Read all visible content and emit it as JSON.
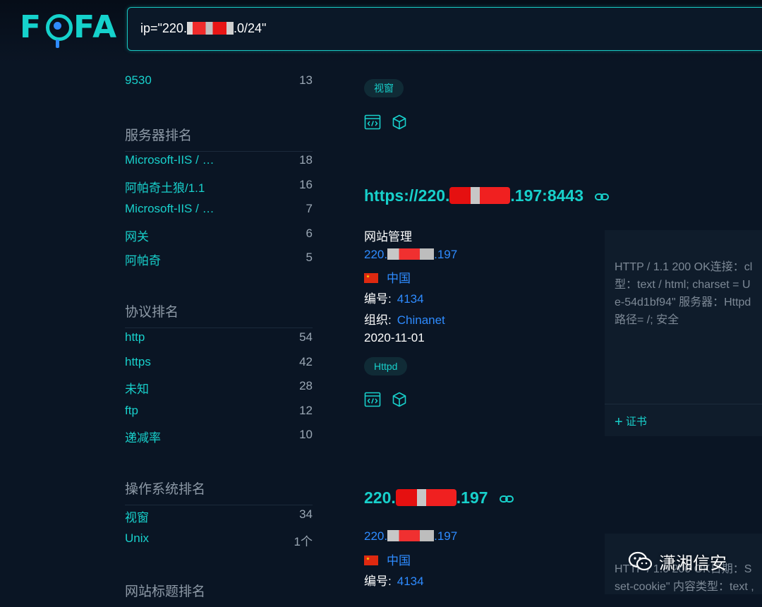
{
  "header": {
    "logo": "FOFA",
    "search_value": "ip=\"220.",
    "search_suffix": ".0/24\""
  },
  "sidebar": {
    "top_item": {
      "label": "9530",
      "count": "13"
    },
    "server_rank": {
      "title": "服务器排名",
      "items": [
        {
          "label": "Microsoft-IIS / …",
          "count": "18"
        },
        {
          "label": "阿帕奇土狼/1.1",
          "count": "16"
        },
        {
          "label": "Microsoft-IIS / …",
          "count": "7"
        },
        {
          "label": "网关",
          "count": "6"
        },
        {
          "label": "阿帕奇",
          "count": "5"
        }
      ]
    },
    "protocol_rank": {
      "title": "协议排名",
      "items": [
        {
          "label": "http",
          "count": "54"
        },
        {
          "label": "https",
          "count": "42"
        },
        {
          "label": "未知",
          "count": "28"
        },
        {
          "label": "ftp",
          "count": "12"
        },
        {
          "label": "递减率",
          "count": "10"
        }
      ]
    },
    "os_rank": {
      "title": "操作系统排名",
      "items": [
        {
          "label": "视窗",
          "count": "34"
        },
        {
          "label": "Unix",
          "count": "1个"
        }
      ]
    },
    "site_title_rank": {
      "title": "网站标题排名"
    }
  },
  "results": [
    {
      "tag": "视窗"
    },
    {
      "title_prefix": "https://220.",
      "title_suffix": ".197:8443",
      "site_title": "网站管理",
      "ip_prefix": "220.",
      "ip_suffix": ".197",
      "country": "中国",
      "asn_label": "编号:",
      "asn": "4134",
      "org_label": "组织:",
      "org": "Chinanet",
      "date": "2020-11-01",
      "tag": "Httpd",
      "banner_lines": [
        "HTTP / 1.1 200 OK连接：cl",
        "型：text / html; charset = U",
        "e-54d1bf94\" 服务器：Httpd",
        "路径= /; 安全"
      ],
      "cert_label": "证书"
    },
    {
      "title_prefix": "220.",
      "title_suffix": ".197",
      "ip_prefix": "220.",
      "ip_suffix": ".197",
      "country": "中国",
      "asn_label": "编号:",
      "asn": "4134",
      "banner_lines": [
        "HTTP / 1.0 200 OK日期：S",
        "set-cookie\" 内容类型：text ,"
      ]
    }
  ],
  "watermark": "潇湘信安",
  "colors": {
    "accent": "#18d0cb",
    "link": "#2e8bff",
    "background": "#0a1524"
  }
}
